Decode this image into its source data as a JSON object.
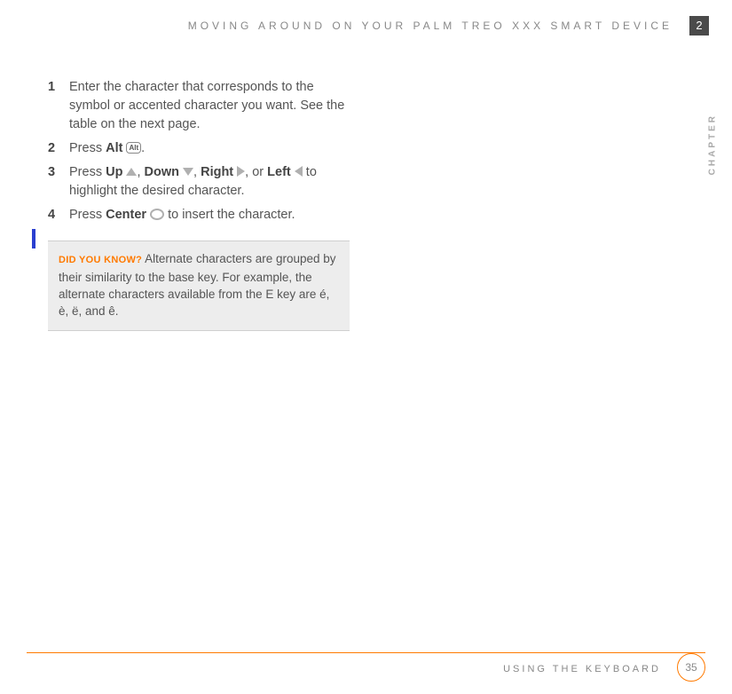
{
  "header": {
    "title": "MOVING AROUND ON YOUR PALM TREO XXX SMART DEVICE",
    "chapter_number": "2",
    "chapter_label": "CHAPTER"
  },
  "steps": [
    {
      "num": "1",
      "text": "Enter the character that corresponds to the symbol or accented character you want. See the table on the next page."
    },
    {
      "num": "2",
      "prefix": "Press ",
      "bold1": "Alt",
      "suffix": "."
    },
    {
      "num": "3",
      "prefix": "Press ",
      "bold_up": "Up",
      "bold_down": "Down",
      "bold_right": "Right",
      "bold_left": "Left",
      "tail": " to highlight the desired character."
    },
    {
      "num": "4",
      "prefix": "Press ",
      "bold1": "Center",
      "suffix": " to insert the character."
    }
  ],
  "note": {
    "label": "DID YOU KNOW?",
    "text": "Alternate characters are grouped by their similarity to the base key. For example, the alternate characters available from the E key are é, è, ë, and ê."
  },
  "icons": {
    "alt_key": "Alt"
  },
  "footer": {
    "section": "USING THE KEYBOARD",
    "page": "35"
  }
}
